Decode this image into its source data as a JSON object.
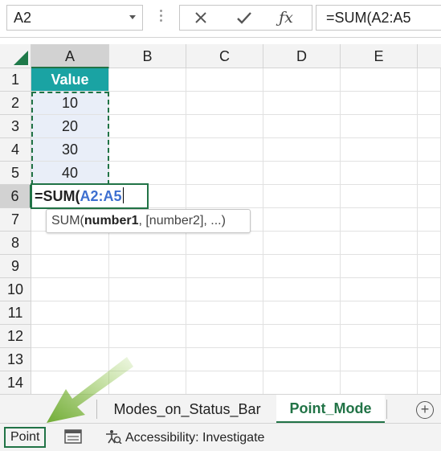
{
  "namebox": {
    "value": "A2"
  },
  "formula_bar": {
    "value": "=SUM(A2:A5"
  },
  "columns": [
    "A",
    "B",
    "C",
    "D",
    "E"
  ],
  "rows": [
    "1",
    "2",
    "3",
    "4",
    "5",
    "6",
    "7",
    "8",
    "9",
    "10",
    "11",
    "12",
    "13",
    "14"
  ],
  "cells": {
    "A1": "Value",
    "A2": "10",
    "A3": "20",
    "A4": "30",
    "A5": "40"
  },
  "active_cell": {
    "prefix": "=SUM(",
    "ref": "A2:A5"
  },
  "tooltip": {
    "func": "SUM(",
    "arg1": "number1",
    "rest": ", [number2], ...)"
  },
  "sheet_tabs": [
    "Modes_on_Status_Bar",
    "Point_Mode"
  ],
  "status_bar": {
    "mode": "Point",
    "accessibility": "Accessibility: Investigate"
  },
  "colors": {
    "accent": "#217346",
    "header_fill": "#1aa3a3",
    "data_fill": "#e9eef8"
  }
}
